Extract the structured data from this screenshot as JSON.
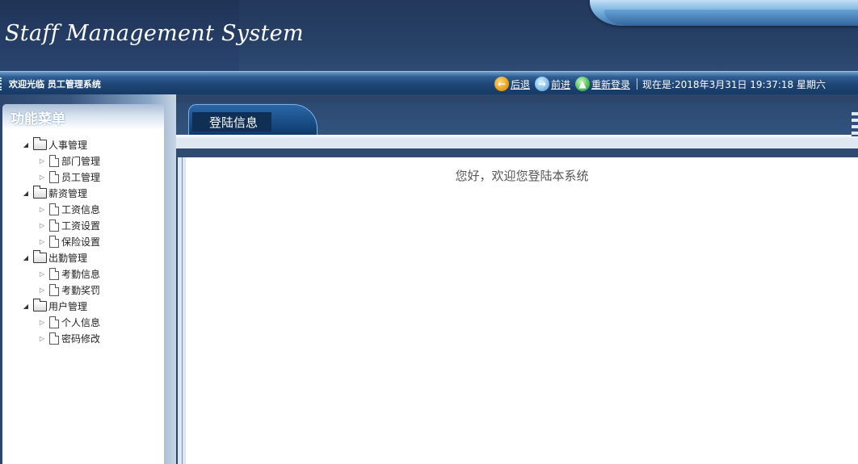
{
  "header": {
    "title": "Staff Management System"
  },
  "infobar": {
    "welcome": "欢迎光临 员工管理系统",
    "back_label": "后退",
    "forward_label": "前进",
    "relogin_label": "重新登录",
    "datetime": "现在是:2018年3月31日 19:37:18 星期六"
  },
  "sidebar": {
    "title": "功能菜单",
    "groups": [
      {
        "label": "人事管理",
        "items": [
          {
            "label": "部门管理"
          },
          {
            "label": "员工管理"
          }
        ]
      },
      {
        "label": "薪资管理",
        "items": [
          {
            "label": "工资信息"
          },
          {
            "label": "工资设置"
          },
          {
            "label": "保险设置"
          }
        ]
      },
      {
        "label": "出勤管理",
        "items": [
          {
            "label": "考勤信息"
          },
          {
            "label": "考勤奖罚"
          }
        ]
      },
      {
        "label": "用户管理",
        "items": [
          {
            "label": "个人信息"
          },
          {
            "label": "密码修改"
          }
        ]
      }
    ]
  },
  "main": {
    "tab_label": "登陆信息",
    "greeting": "您好，欢迎您登陆本系统"
  }
}
